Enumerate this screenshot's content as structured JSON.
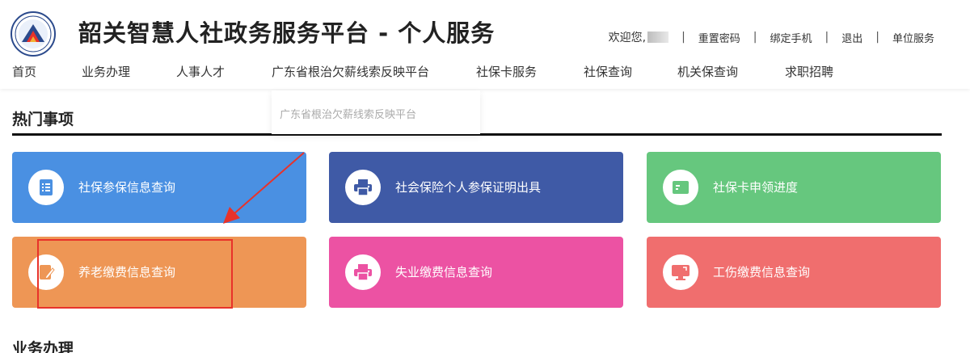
{
  "header": {
    "title": "韶关智慧人社政务服务平台 - 个人服务",
    "user_links": {
      "welcome": "欢迎您,",
      "reset_password": "重置密码",
      "bind_phone": "绑定手机",
      "logout": "退出",
      "employer_service": "单位服务"
    }
  },
  "nav": {
    "items": [
      "首页",
      "业务办理",
      "人事人才",
      "广东省根治欠薪线索反映平台",
      "社保卡服务",
      "社保查询",
      "机关保查询",
      "求职招聘"
    ]
  },
  "dropdown": {
    "item": "广东省根治欠薪线索反映平台"
  },
  "hot_section": {
    "title": "热门事项",
    "cards": [
      {
        "label": "社保参保信息查询",
        "color": "#4a90e2",
        "icon": "list-icon"
      },
      {
        "label": "社会保险个人参保证明出具",
        "color": "#3f5aa6",
        "icon": "printer-icon"
      },
      {
        "label": "社保卡申领进度",
        "color": "#66c77e",
        "icon": "card-icon"
      },
      {
        "label": "养老缴费信息查询",
        "color": "#ee9655",
        "icon": "edit-icon"
      },
      {
        "label": "失业缴费信息查询",
        "color": "#ec52a3",
        "icon": "printer-icon"
      },
      {
        "label": "工伤缴费信息查询",
        "color": "#f06e6e",
        "icon": "monitor-icon"
      }
    ]
  },
  "business_section": {
    "title": "业务办理"
  },
  "colors": {
    "annotation": "#e8322a"
  }
}
